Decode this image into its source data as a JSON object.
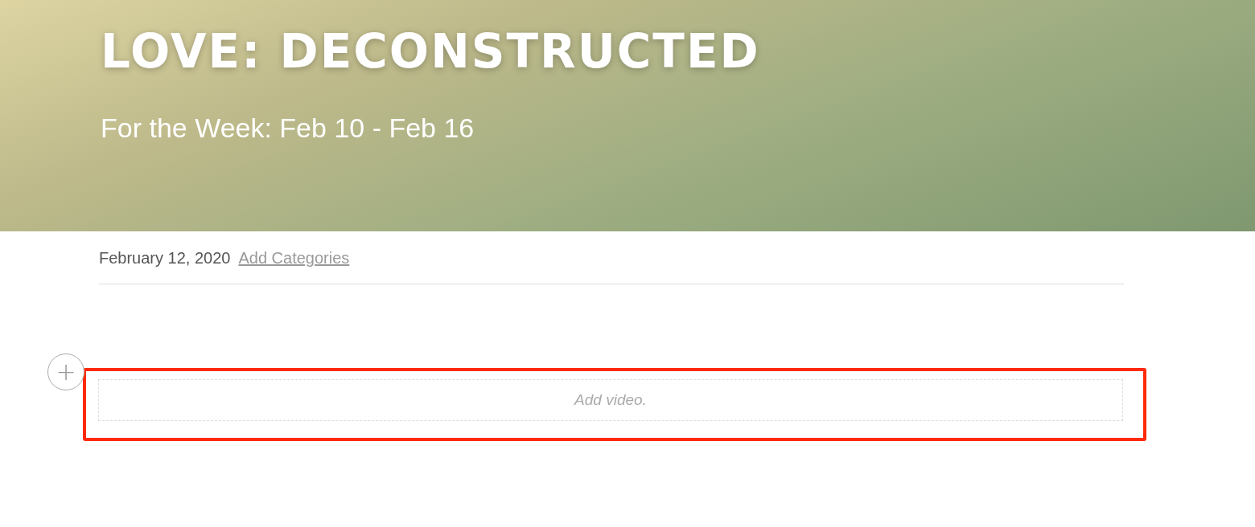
{
  "header": {
    "title": "LOVE: DECONSTRUCTED",
    "subtitle": "For the Week: Feb 10 - Feb 16"
  },
  "meta": {
    "date": "February 12, 2020",
    "link": "Add Categories"
  },
  "block": {
    "add_symbol": "+",
    "placeholder": "Add video."
  }
}
